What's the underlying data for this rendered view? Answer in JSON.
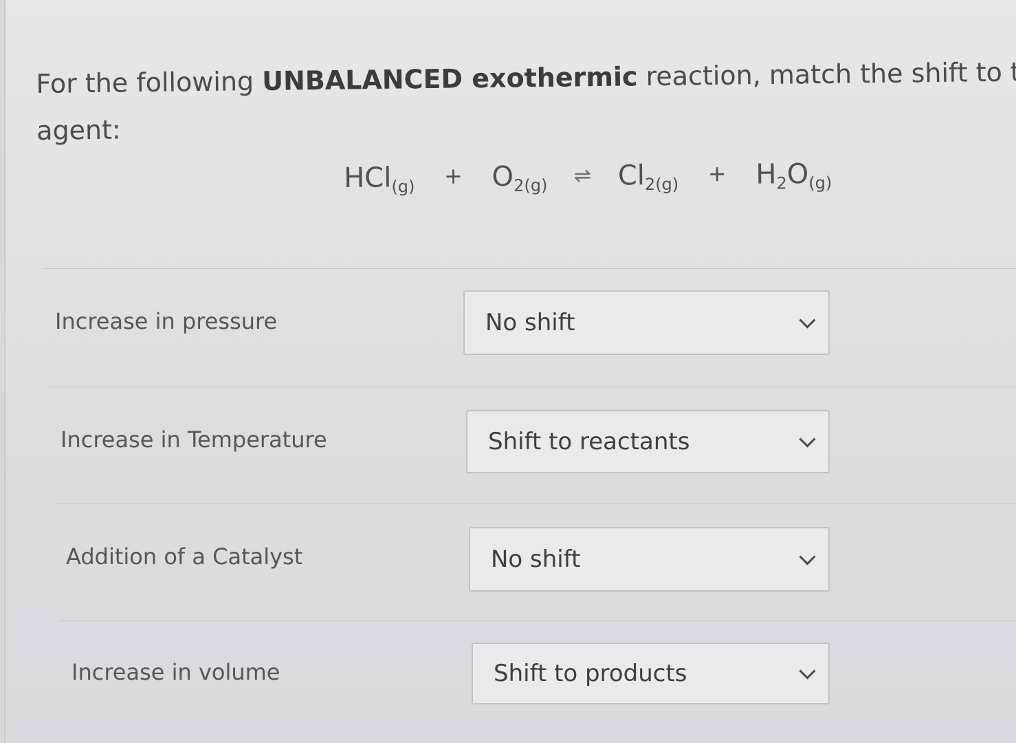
{
  "question": {
    "prefix": "For the following ",
    "emphasis": "UNBALANCED exothermic",
    "suffix_line1": " reaction, match the shift to the caus",
    "line2": "agent:"
  },
  "equation": {
    "term1": "HCl",
    "term1_state": "(g)",
    "plus1": "+",
    "term2": "O",
    "term2_sub": "2(g)",
    "arrow": "⇌",
    "term3": "Cl",
    "term3_sub": "2(g)",
    "plus2": "+",
    "term4_a": "H",
    "term4_sub": "2",
    "term4_b": "O",
    "term4_state": "(g)"
  },
  "rows": [
    {
      "label": "Increase in pressure",
      "selected": "No shift"
    },
    {
      "label": "Increase in Temperature",
      "selected": "Shift to reactants"
    },
    {
      "label": "Addition of a Catalyst",
      "selected": "No shift"
    },
    {
      "label": "Increase in volume",
      "selected": "Shift to products"
    }
  ],
  "icons": {
    "dropdown": "chevron-down-icon"
  }
}
